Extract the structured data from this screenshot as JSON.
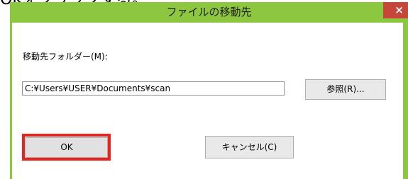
{
  "instruction": {
    "text": "OKをクリックする。"
  },
  "dialog": {
    "title": "ファイルの移動先",
    "close_label": "×",
    "folder_label": "移動先フォルダー(M):",
    "path_value": "C:¥Users¥USER¥Documents¥scan",
    "browse_label": "参照(R)...",
    "ok_label": "OK",
    "cancel_label": "キャンセル(C)"
  },
  "colors": {
    "titlebar": "#8dc63f",
    "close_button": "#c7463a",
    "highlight": "#e8231e"
  },
  "icons": {
    "close": "close-icon"
  }
}
